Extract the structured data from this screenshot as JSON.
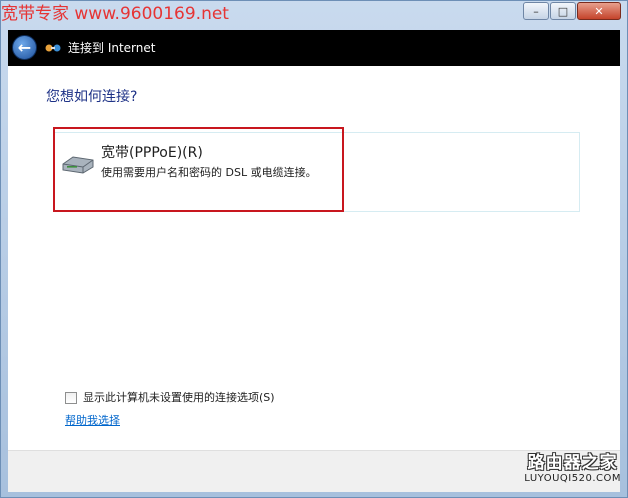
{
  "watermark": {
    "text": "宽带专家 www.9600169.net"
  },
  "window": {
    "caption_minimize": "–",
    "caption_maximize": "□",
    "caption_close": "✕"
  },
  "nav": {
    "back_glyph": "←",
    "title": "连接到 Internet"
  },
  "main": {
    "heading": "您想如何连接?",
    "option": {
      "title": "宽带(PPPoE)(R)",
      "description": "使用需要用户名和密码的 DSL 或电缆连接。",
      "icon": "modem-icon"
    },
    "checkbox": {
      "label": "显示此计算机未设置使用的连接选项(S)",
      "checked": false
    },
    "help_link": "帮助我选择"
  },
  "branding": {
    "name": "路由器之家",
    "url": "LUYOUQI520.COM"
  },
  "colors": {
    "highlight": "#c8171e",
    "heading": "#1e3287",
    "link": "#0066cc",
    "watermark": "#e63434"
  }
}
